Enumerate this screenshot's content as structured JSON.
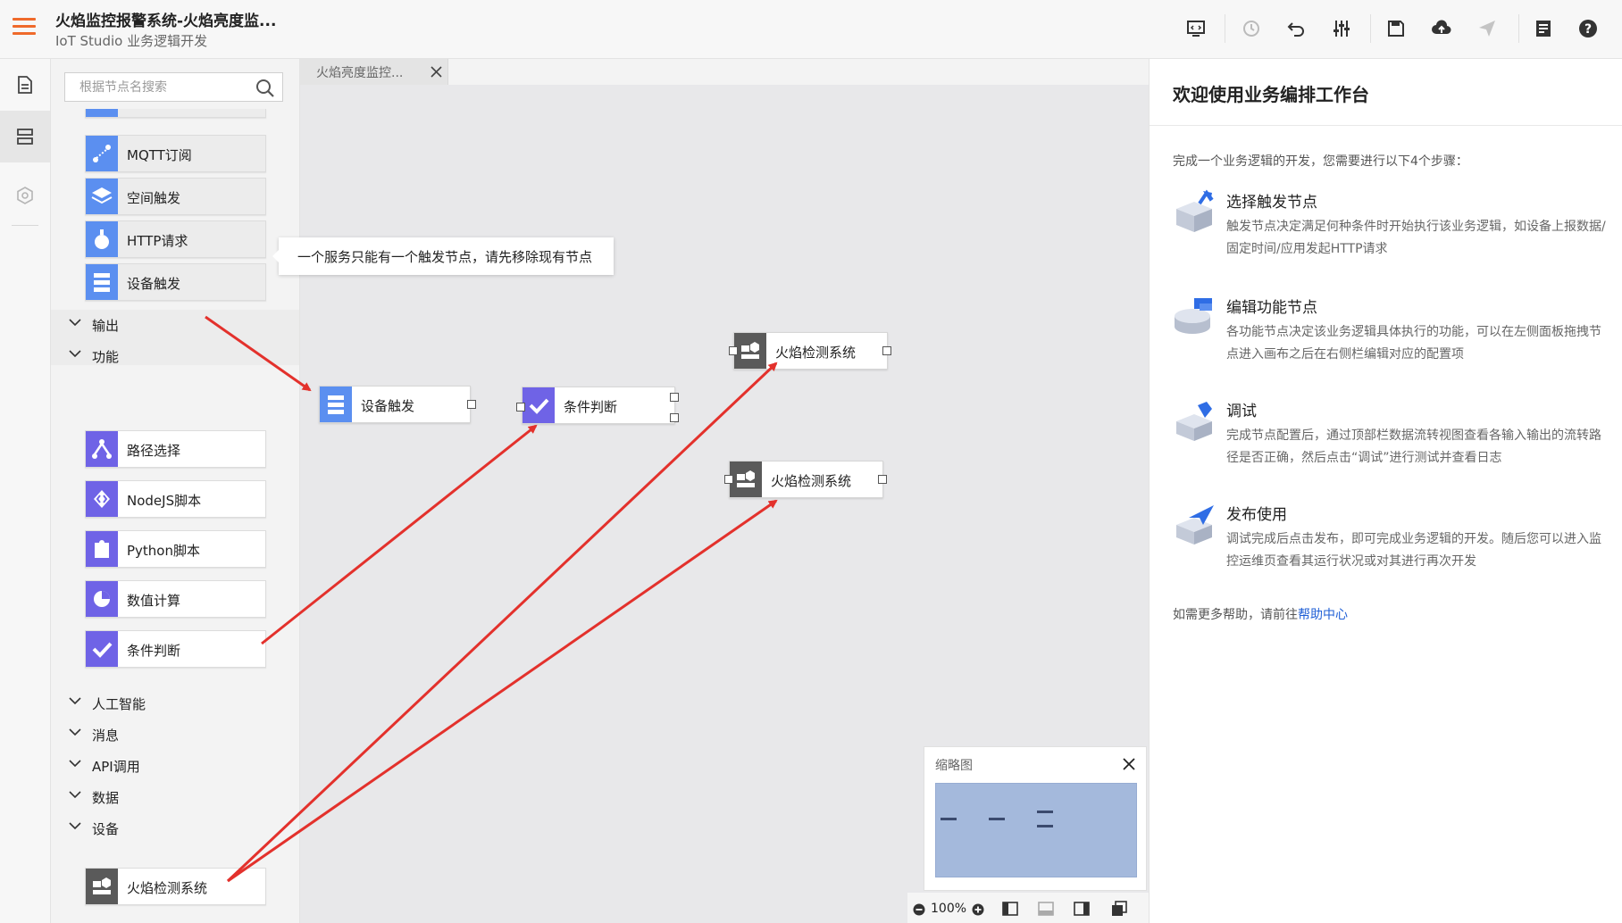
{
  "header": {
    "title": "火焰监控报警系统-火焰亮度监...",
    "subtitle": "IoT Studio 业务逻辑开发"
  },
  "colors": {
    "accent": "#ef6a2b",
    "blue": "#5b8ff0",
    "purple": "#6f63e6",
    "gray_icon": "#5a5a5a",
    "arrow": "#e3312c",
    "link": "#1f5fd6"
  },
  "toolbar": [
    "monitor-icon",
    "history-icon",
    "undo-icon",
    "settings-sliders-icon",
    "save-icon",
    "cloud-deploy-icon",
    "publish-icon",
    "log-icon",
    "help-icon"
  ],
  "left_panel": {
    "search_placeholder": "根据节点名搜索",
    "trigger_nodes": [
      "MQTT订阅",
      "空间触发",
      "HTTP请求",
      "设备触发"
    ],
    "categories_top": [
      "输出",
      "功能"
    ],
    "function_nodes": [
      "路径选择",
      "NodeJS脚本",
      "Python脚本",
      "数值计算",
      "条件判断"
    ],
    "categories_bottom": [
      "人工智能",
      "消息",
      "API调用",
      "数据",
      "设备"
    ],
    "device_nodes": [
      "火焰检测系统"
    ]
  },
  "tooltip": "一个服务只能有一个触发节点，请先移除现有节点",
  "tab": {
    "label": "火焰亮度监控..."
  },
  "canvas_nodes": {
    "trigger": "设备触发",
    "condition": "条件判断",
    "device1": "火焰检测系统",
    "device2": "火焰检测系统"
  },
  "minimap": {
    "title": "缩略图"
  },
  "zoom": {
    "value": "100%"
  },
  "right_panel": {
    "title": "欢迎使用业务编排工作台",
    "intro": "完成一个业务逻辑的开发，您需要进行以下4个步骤：",
    "steps": [
      {
        "title": "选择触发节点",
        "desc": "触发节点决定满足何种条件时开始执行该业务逻辑，如设备上报数据/固定时间/应用发起HTTP请求"
      },
      {
        "title": "编辑功能节点",
        "desc": "各功能节点决定该业务逻辑具体执行的功能，可以在左侧面板拖拽节点进入画布之后在右侧栏编辑对应的配置项"
      },
      {
        "title": "调试",
        "desc": "完成节点配置后，通过顶部栏数据流转视图查看各输入输出的流转路径是否正确，然后点击“调试”进行测试并查看日志"
      },
      {
        "title": "发布使用",
        "desc": "调试完成后点击发布，即可完成业务逻辑的开发。随后您可以进入监控运维页查看其运行状况或对其进行再次开发"
      }
    ],
    "help_prefix": "如需更多帮助，请前往",
    "help_link": "帮助中心"
  }
}
